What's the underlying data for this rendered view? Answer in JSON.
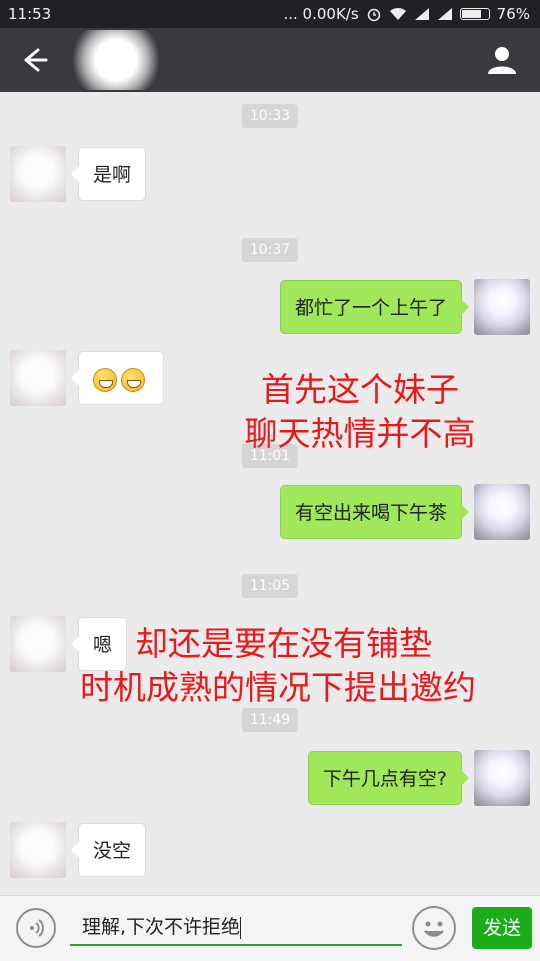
{
  "status_bar": {
    "time": "11:53",
    "network_speed": "... 0.00K/s",
    "battery_percent": "76%",
    "battery_level": 0.76
  },
  "header": {
    "back_icon": "back-arrow-icon",
    "contact_icon": "person-icon"
  },
  "messages": [
    {
      "type": "timestamp",
      "text": "10:33"
    },
    {
      "type": "received",
      "text": "是啊"
    },
    {
      "type": "timestamp",
      "text": "10:37"
    },
    {
      "type": "sent",
      "text": "都忙了一个上午了"
    },
    {
      "type": "received_emoji",
      "emoji": "grinning-face-icon",
      "count": 2
    },
    {
      "type": "timestamp",
      "text": "11:01"
    },
    {
      "type": "sent",
      "text": "有空出来喝下午茶"
    },
    {
      "type": "timestamp",
      "text": "11:05"
    },
    {
      "type": "received",
      "text": "嗯"
    },
    {
      "type": "timestamp",
      "text": "11:49"
    },
    {
      "type": "sent",
      "text": "下午几点有空?"
    },
    {
      "type": "received",
      "text": "没空"
    }
  ],
  "annotations": [
    {
      "line1": "首先这个妹子",
      "line2": "聊天热情并不高"
    },
    {
      "line1": "却还是要在没有铺垫",
      "line2": "时机成熟的情况下提出邀约"
    }
  ],
  "input_bar": {
    "input_value": "理解,下次不许拒绝",
    "send_label": "发送",
    "voice_icon": "voice-icon",
    "emoji_icon": "emoji-icon"
  },
  "colors": {
    "header_bg": "#393a3f",
    "sent_bubble": "#a0e75a",
    "send_button": "#1aad19",
    "annotation_text": "#e8181c"
  }
}
